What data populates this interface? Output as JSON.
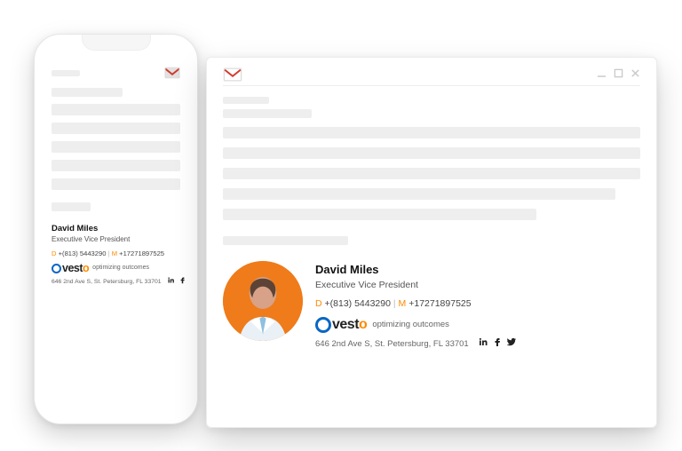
{
  "signature": {
    "name": "David Miles",
    "title": "Executive Vice President",
    "direct_label": "D",
    "direct_phone": "+(813) 5443290",
    "separator": "|",
    "mobile_label": "M",
    "mobile_phone": "+17271897525",
    "tagline": "optimizing outcomes",
    "address": "646 2nd Ave S, St. Petersburg, FL 33701",
    "logo_text_prefix": "vest",
    "logo_text_suffix": "o"
  }
}
